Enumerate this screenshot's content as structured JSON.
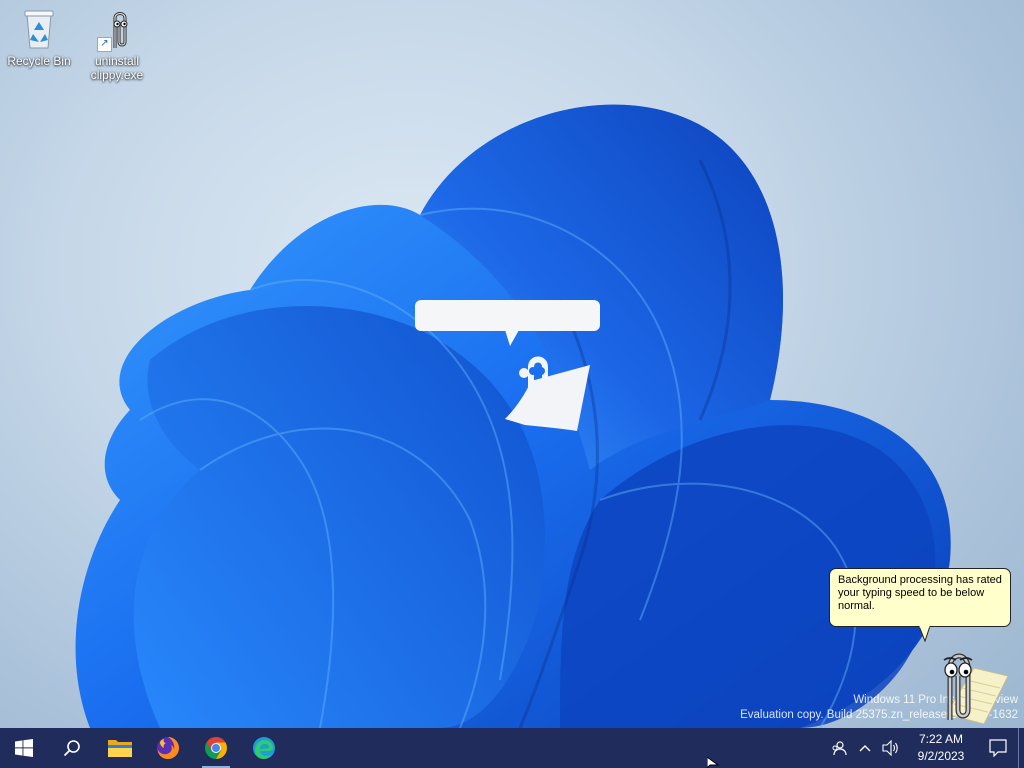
{
  "desktop": {
    "icons": [
      {
        "label": "Recycle Bin",
        "icon": "recycle-bin-icon"
      },
      {
        "label": "uninstall\nclippy.exe",
        "label_line1": "uninstall",
        "label_line2": "clippy.exe",
        "icon": "paperclip-icon"
      }
    ]
  },
  "clippy_tip": {
    "message": "Background processing has rated your typing speed to be below normal."
  },
  "watermark": {
    "line1": "Windows 11 Pro Insider Preview",
    "line2": "Evaluation copy. Build 25375.zn_release.230520-1632"
  },
  "taskbar": {
    "apps": [
      {
        "name": "start",
        "icon": "windows-logo-icon"
      },
      {
        "name": "search",
        "icon": "search-icon"
      },
      {
        "name": "file-explorer",
        "icon": "folder-icon"
      },
      {
        "name": "firefox",
        "icon": "firefox-icon"
      },
      {
        "name": "chrome",
        "icon": "chrome-icon",
        "running": true
      },
      {
        "name": "edge",
        "icon": "edge-icon"
      }
    ],
    "tray": {
      "icons": [
        "people-icon",
        "chevron-up-icon",
        "volume-icon"
      ],
      "time": "7:22 AM",
      "date": "9/2/2023",
      "notification_icon": "notification-icon"
    }
  },
  "colors": {
    "taskbar_bg": "#202d5c",
    "tip_bg": "#ffffcc",
    "bloom_blue": "#1a6ff0"
  }
}
